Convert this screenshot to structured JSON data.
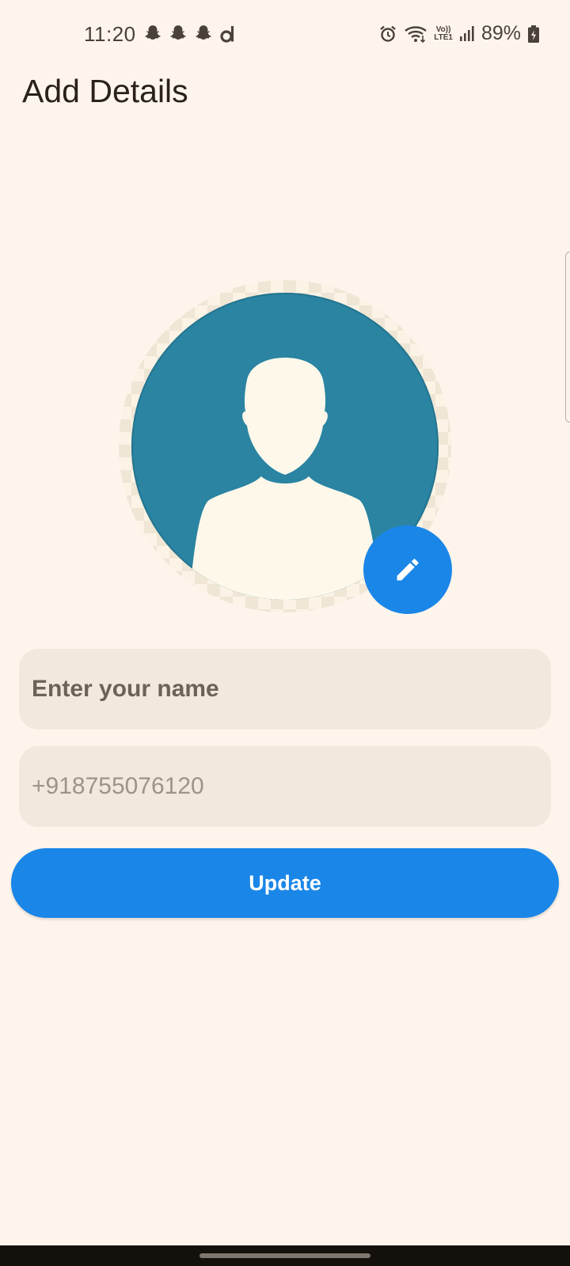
{
  "status_bar": {
    "time": "11:20",
    "left_icons": [
      "snapchat-icon",
      "snapchat-icon",
      "snapchat-icon",
      "d-app-icon"
    ],
    "right_icons": [
      "alarm-icon",
      "wifi-icon",
      "volte-icon",
      "signal-icon",
      "battery-charging-icon"
    ],
    "volte_top": "Vo))",
    "volte_bottom": "LTE1",
    "battery": "89%"
  },
  "header": {
    "title": "Add Details"
  },
  "avatar": {
    "icon": "person-silhouette-icon",
    "edit_icon": "pencil-icon"
  },
  "form": {
    "name_placeholder": "Enter your name",
    "phone_placeholder": "+918755076120",
    "update_label": "Update"
  },
  "colors": {
    "background": "#FDF5EC",
    "accent": "#1A86E8",
    "avatar_bg": "#2A84A2",
    "field_bg": "#F1E9DD"
  }
}
